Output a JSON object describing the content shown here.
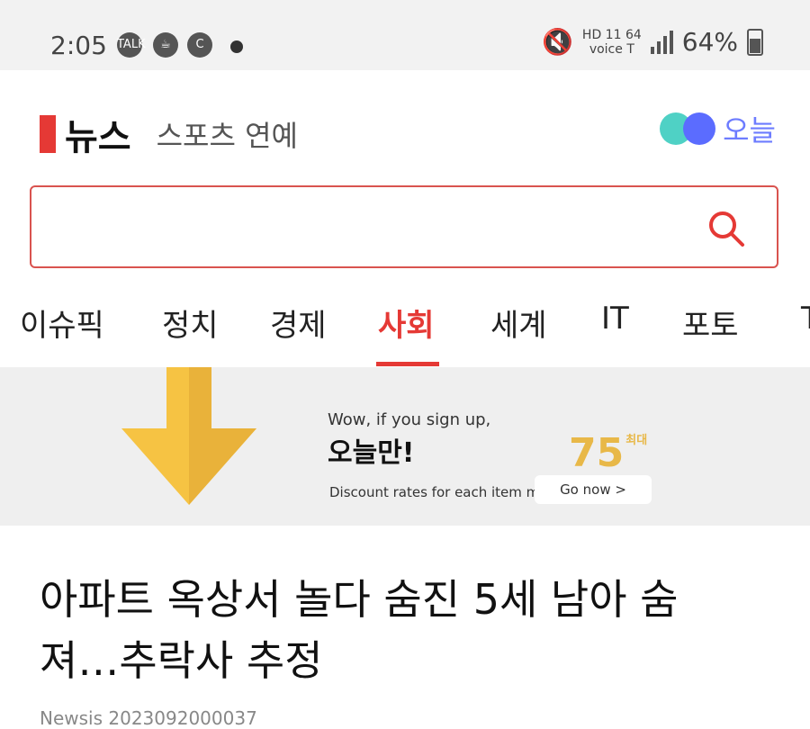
{
  "status_bar": {
    "time": "2:05",
    "talk": "TALK",
    "network": "HD 11 64",
    "carrier": "voice T",
    "battery": "64%"
  },
  "header": {
    "logo": "뉴스",
    "sub_tabs": "스포츠  연예",
    "today_label": "오늘"
  },
  "search": {
    "placeholder": ""
  },
  "nav": {
    "tabs": [
      {
        "label": "이슈픽"
      },
      {
        "label": "정치"
      },
      {
        "label": "경제"
      },
      {
        "label": "사회"
      },
      {
        "label": "세계"
      },
      {
        "label": "IT"
      },
      {
        "label": "포토"
      },
      {
        "label": "T"
      }
    ],
    "active_index": 3
  },
  "banner": {
    "line1": "Wow, if you sign up,",
    "line2": "오늘만!",
    "line3": "Discount rates for each item ma",
    "percent": "75",
    "max_label": "최대",
    "go": "Go now >"
  },
  "article": {
    "title_line1": "아파트 옥상서 놀다 숨진 5세 남아 숨",
    "title_line2": "져…추락사 추정",
    "source": "Newsis 2023092000037"
  },
  "colors": {
    "accent": "#e53935",
    "banner_bg": "#efefef",
    "today_blue": "#6d7cff"
  }
}
